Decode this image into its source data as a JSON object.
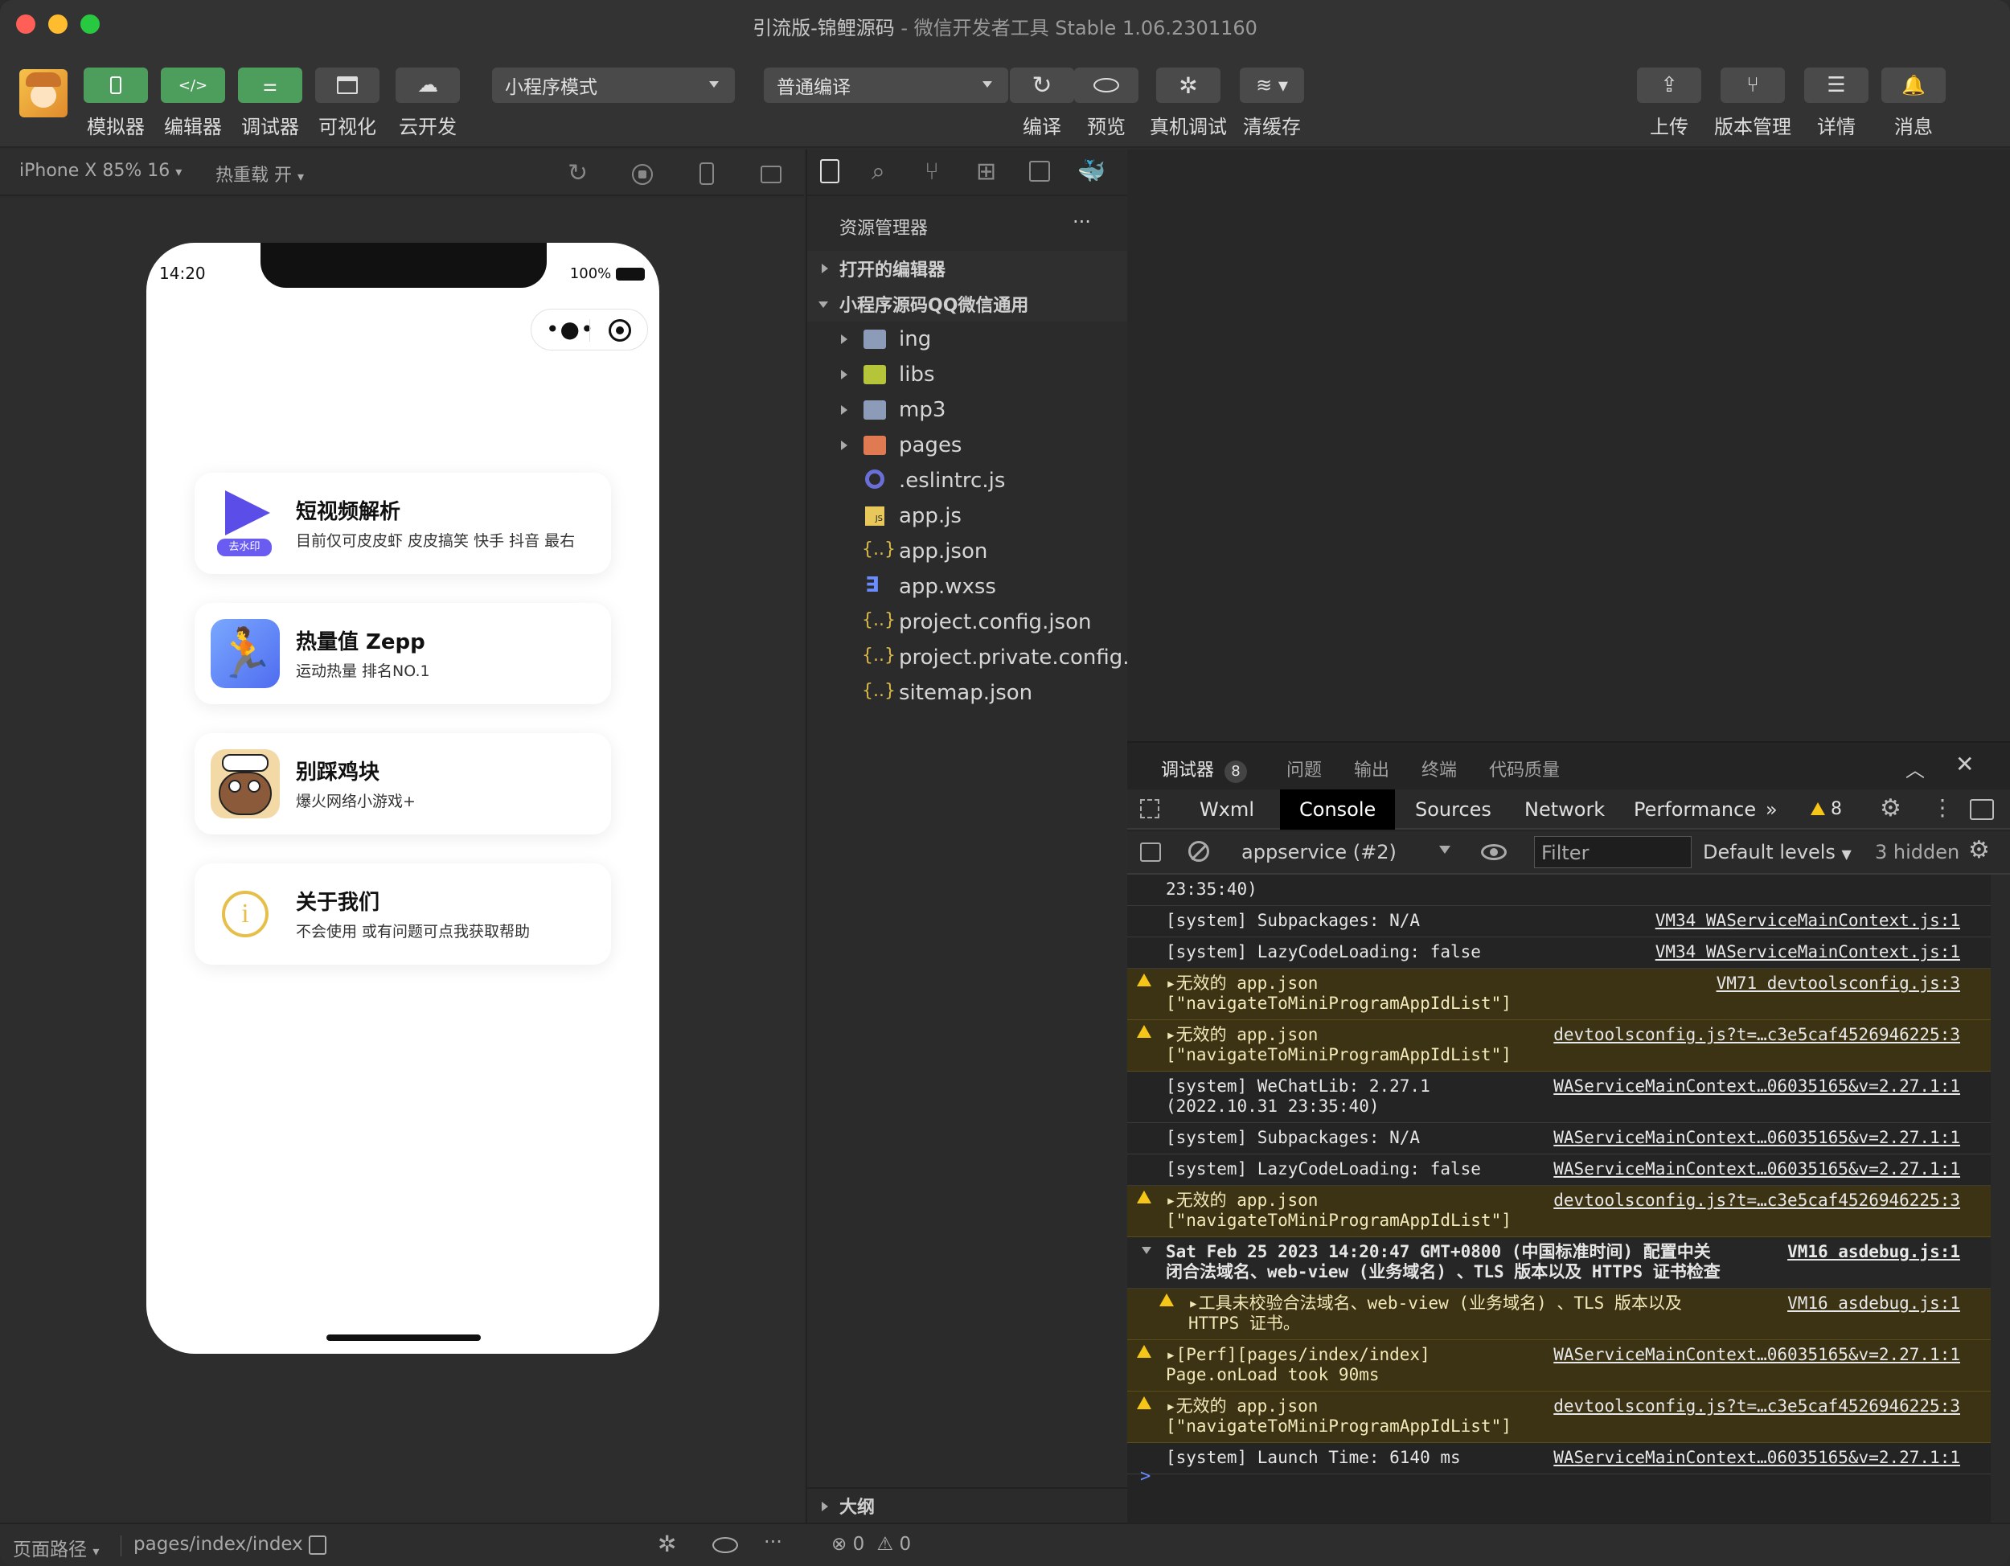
{
  "window": {
    "title_main": "引流版-锦鲤源码",
    "title_sep": " - ",
    "title_app": "微信开发者工具 Stable 1.06.2301160"
  },
  "toolbar": {
    "left_labels": [
      "模拟器",
      "编辑器",
      "调试器",
      "可视化",
      "云开发"
    ],
    "mode_select": "小程序模式",
    "compile_select": "普通编译",
    "mid_labels": [
      "编译",
      "预览",
      "真机调试",
      "清缓存"
    ],
    "right_labels": [
      "上传",
      "版本管理",
      "详情",
      "消息"
    ]
  },
  "simulator": {
    "device": "iPhone X 85% 16",
    "hot_reload": "热重载 开",
    "time": "14:20",
    "battery": "100%",
    "cards": [
      {
        "title": "短视频解析",
        "subtitle": "目前仅可皮皮虾 皮皮搞笑 快手 抖音 最右",
        "badge": "去水印"
      },
      {
        "title": "热量值 Zepp",
        "subtitle": "运动热量 排名NO.1"
      },
      {
        "title": "别踩鸡块",
        "subtitle": "爆火网络小游戏+"
      },
      {
        "title": "关于我们",
        "subtitle": "不会使用 或有问题可点我获取帮助"
      }
    ]
  },
  "explorer": {
    "header": "资源管理器",
    "more": "···",
    "open_editors": "打开的编辑器",
    "project": "小程序源码QQ微信通用",
    "files": [
      {
        "name": "ing",
        "type": "folder"
      },
      {
        "name": "libs",
        "type": "folder-libs"
      },
      {
        "name": "mp3",
        "type": "folder"
      },
      {
        "name": "pages",
        "type": "folder-pages"
      },
      {
        "name": ".eslintrc.js",
        "type": "eslint"
      },
      {
        "name": "app.js",
        "type": "js"
      },
      {
        "name": "app.json",
        "type": "json"
      },
      {
        "name": "app.wxss",
        "type": "wxss"
      },
      {
        "name": "project.config.json",
        "type": "json"
      },
      {
        "name": "project.private.config...",
        "type": "json"
      },
      {
        "name": "sitemap.json",
        "type": "json"
      }
    ],
    "outline": "大纲",
    "errors": "0",
    "warnings": "0"
  },
  "devtools": {
    "top_tabs": [
      "调试器",
      "问题",
      "输出",
      "终端",
      "代码质量"
    ],
    "debugger_badge": "8",
    "tabs": [
      "Wxml",
      "Console",
      "Sources",
      "Network",
      "Performance"
    ],
    "active_tab": "Console",
    "more_tabs": "»",
    "warn_count": "8",
    "context": "appservice (#2)",
    "filter_placeholder": "Filter",
    "levels": "Default levels",
    "hidden": "3 hidden",
    "prompt": ">",
    "logs": [
      {
        "level": "info",
        "msg": "23:35:40)",
        "src": ""
      },
      {
        "level": "info",
        "msg": "[system] Subpackages: N/A",
        "src": "VM34 WAServiceMainContext.js:1"
      },
      {
        "level": "info",
        "msg": "[system] LazyCodeLoading: false",
        "src": "VM34 WAServiceMainContext.js:1"
      },
      {
        "level": "warn",
        "msg": "▸无效的 app.json\n[\"navigateToMiniProgramAppIdList\"]",
        "src": "VM71 devtoolsconfig.js:3"
      },
      {
        "level": "warn",
        "msg": "▸无效的 app.json\n[\"navigateToMiniProgramAppIdList\"]",
        "src": "devtoolsconfig.js?t=…c3e5caf4526946225:3"
      },
      {
        "level": "info",
        "msg": "[system] WeChatLib: 2.27.1\n(2022.10.31 23:35:40)",
        "src": "WAServiceMainContext…06035165&v=2.27.1:1"
      },
      {
        "level": "info",
        "msg": "[system] Subpackages: N/A",
        "src": "WAServiceMainContext…06035165&v=2.27.1:1"
      },
      {
        "level": "info",
        "msg": "[system] LazyCodeLoading: false",
        "src": "WAServiceMainContext…06035165&v=2.27.1:1"
      },
      {
        "level": "warn",
        "msg": "▸无效的 app.json\n[\"navigateToMiniProgramAppIdList\"]",
        "src": "devtoolsconfig.js?t=…c3e5caf4526946225:3"
      },
      {
        "level": "group",
        "msg": "Sat Feb 25 2023 14:20:47 GMT+0800 (中国标准时间) 配置中关\n闭合法域名、web-view (业务域名) 、TLS 版本以及 HTTPS 证书检查",
        "src": "VM16 asdebug.js:1"
      },
      {
        "level": "warn-nested",
        "msg": "▸工具未校验合法域名、web-view (业务域名) 、TLS 版本以及\nHTTPS 证书。",
        "src": "VM16 asdebug.js:1"
      },
      {
        "level": "warn",
        "msg": "▸[Perf][pages/index/index]\nPage.onLoad took 90ms",
        "src": "WAServiceMainContext…06035165&v=2.27.1:1"
      },
      {
        "level": "warn",
        "msg": "▸无效的 app.json\n[\"navigateToMiniProgramAppIdList\"]",
        "src": "devtoolsconfig.js?t=…c3e5caf4526946225:3"
      },
      {
        "level": "info",
        "msg": "[system] Launch Time: 6140 ms",
        "src": "WAServiceMainContext…06035165&v=2.27.1:1"
      }
    ]
  },
  "statusbar": {
    "route_label": "页面路径",
    "route": "pages/index/index"
  }
}
